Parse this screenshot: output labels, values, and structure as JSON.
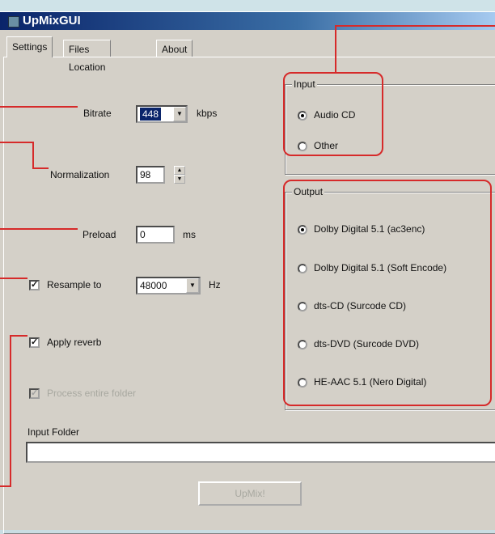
{
  "window": {
    "title": "UpMixGUI"
  },
  "tabs": [
    {
      "label": "Settings"
    },
    {
      "label": "Files Location"
    },
    {
      "label": "About"
    }
  ],
  "settings": {
    "bitrate": {
      "label": "Bitrate",
      "value": "448",
      "unit": "kbps"
    },
    "normalization": {
      "label": "Normalization",
      "value": "98"
    },
    "preload": {
      "label": "Preload",
      "value": "0",
      "unit": "ms"
    },
    "resample": {
      "label": "Resample to",
      "checked": true,
      "value": "48000",
      "unit": "Hz"
    },
    "reverb": {
      "label": "Apply reverb",
      "checked": true
    },
    "process_folder": {
      "label": "Process entire folder",
      "checked": true,
      "enabled": false
    },
    "input_folder": {
      "label": "Input Folder",
      "value": ""
    },
    "upmix_button": {
      "label": "UpMix!",
      "enabled": false
    }
  },
  "input_group": {
    "legend": "Input",
    "options": [
      {
        "label": "Audio CD",
        "selected": true
      },
      {
        "label": "Other",
        "selected": false
      }
    ]
  },
  "output_group": {
    "legend": "Output",
    "options": [
      {
        "label": "Dolby Digital 5.1 (ac3enc)",
        "selected": true
      },
      {
        "label": "Dolby Digital 5.1 (Soft Encode)",
        "selected": false
      },
      {
        "label": "dts-CD (Surcode CD)",
        "selected": false
      },
      {
        "label": "dts-DVD (Surcode DVD)",
        "selected": false
      },
      {
        "label": "HE-AAC 5.1 (Nero Digital)",
        "selected": false
      }
    ]
  },
  "colors": {
    "callout": "#d62a2a",
    "titlebar": "#0a246a",
    "background": "#c9dde3"
  }
}
